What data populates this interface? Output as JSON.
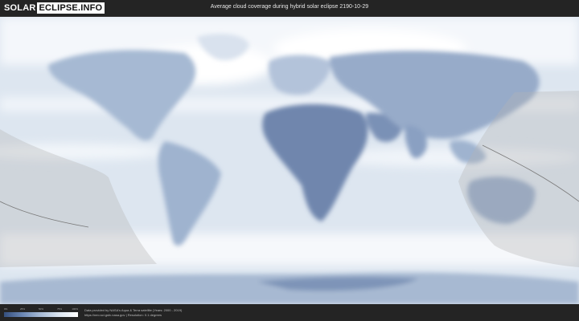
{
  "header": {
    "logo_part1": "SOLAR",
    "logo_part2": "ECLIPSE.INFO",
    "title": "Average cloud coverage during hybrid solar eclipse 2190-10-29"
  },
  "map": {
    "ocean_color": "#dfe8f2",
    "cloud_color": "#ffffff",
    "clear_sky_color": "#5a73a0",
    "eclipse_shading_color": "#b4b4b4"
  },
  "legend": {
    "ticks": [
      "0%",
      "25%",
      "50%",
      "75%",
      "100%"
    ]
  },
  "credits": {
    "line1": "Data provided by NASA's Aqua & Terra satellite (Years: 2000 - 2019)",
    "line2": "https://neo.sci.gsfc.nasa.gov | Resolution: 0.1 degrees"
  }
}
